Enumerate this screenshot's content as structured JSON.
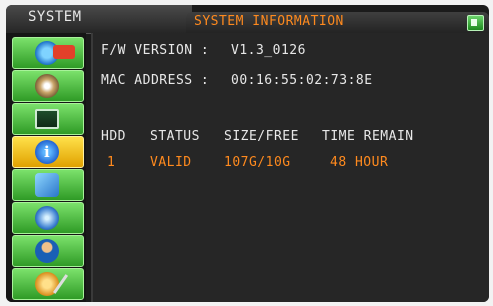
{
  "tabs": {
    "system": "SYSTEM",
    "active": "SYSTEM INFORMATION"
  },
  "sidebar": {
    "items": [
      {
        "icon": "record-icon"
      },
      {
        "icon": "disk-icon"
      },
      {
        "icon": "monitor-icon"
      },
      {
        "icon": "info-icon",
        "active": true
      },
      {
        "icon": "network-icon"
      },
      {
        "icon": "globe-icon"
      },
      {
        "icon": "user-icon"
      },
      {
        "icon": "tools-icon"
      }
    ]
  },
  "info": {
    "fw_label": "F/W VERSION :",
    "fw_value": "V1.3_0126",
    "mac_label": "MAC ADDRESS :",
    "mac_value": "00:16:55:02:73:8E"
  },
  "hdd_table": {
    "headers": [
      "HDD",
      "STATUS",
      "SIZE/FREE",
      "TIME REMAIN"
    ],
    "rows": [
      [
        "1",
        "VALID",
        "107G/10G",
        "48 HOUR"
      ]
    ]
  },
  "colors": {
    "accent": "#ff8a1e",
    "sidebar_green": "#4cc43a",
    "sidebar_active": "#f7c51d"
  }
}
